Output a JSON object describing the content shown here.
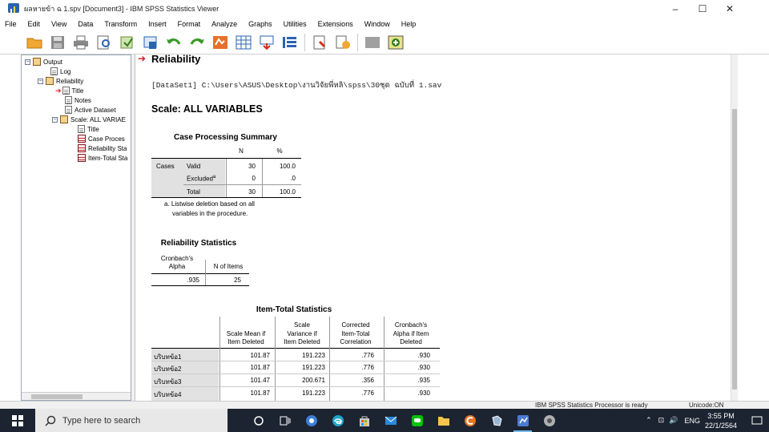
{
  "window": {
    "title": "ผลหายข้า ฉ 1.spv [Document3] - IBM SPSS Statistics Viewer",
    "minimize": "–",
    "maximize": "☐",
    "close": "✕"
  },
  "menu": [
    "File",
    "Edit",
    "View",
    "Data",
    "Transform",
    "Insert",
    "Format",
    "Analyze",
    "Graphs",
    "Utilities",
    "Extensions",
    "Window",
    "Help"
  ],
  "toolbar_icons": [
    "open-folder-icon",
    "save-icon",
    "print-icon",
    "print-preview-icon",
    "export-icon",
    "recall-dialog-icon",
    "undo-icon",
    "redo-icon",
    "goto-data-icon",
    "goto-case-icon",
    "goto-variable-icon",
    "variables-icon",
    "designate-window-icon",
    "insert-output-icon",
    "disabled-icon",
    "add-output-icon"
  ],
  "outline": {
    "nodes": [
      {
        "label": "Output",
        "type": "book",
        "expander": "−"
      },
      {
        "label": "Log",
        "type": "doc"
      },
      {
        "label": "Reliability",
        "type": "book",
        "expander": "−"
      },
      {
        "label": "Title",
        "type": "doc",
        "arrow": "➜"
      },
      {
        "label": "Notes",
        "type": "doc"
      },
      {
        "label": "Active Dataset",
        "type": "doc"
      },
      {
        "label": "Scale: ALL VARIAE",
        "type": "book",
        "expander": "−"
      },
      {
        "label": "Title",
        "type": "doc"
      },
      {
        "label": "Case Proces",
        "type": "tbl"
      },
      {
        "label": "Reliability Sta",
        "type": "tbl"
      },
      {
        "label": "Item-Total Sta",
        "type": "tbl"
      }
    ]
  },
  "content": {
    "heading": "Reliability",
    "heading_arrow": "➜",
    "dataset_line": "[DataSet1] C:\\Users\\ASUS\\Desktop\\งานวิจัยพี่หลิ\\spss\\30ชุด ฉบับที่ 1.sav",
    "scale_heading": "Scale: ALL VARIABLES",
    "case_summary": {
      "title": "Case Processing Summary",
      "col_n": "N",
      "col_pct": "%",
      "group": "Cases",
      "rows": [
        {
          "label": "Valid",
          "n": "30",
          "pct": "100.0"
        },
        {
          "label": "Excluded",
          "sup": "a",
          "n": "0",
          "pct": ".0"
        },
        {
          "label": "Total",
          "n": "30",
          "pct": "100.0"
        }
      ],
      "footnote_1": "a. Listwise deletion based on all",
      "footnote_2": "variables in the procedure."
    },
    "reliability": {
      "title": "Reliability Statistics",
      "col1_line1": "Cronbach's",
      "col1_line2": "Alpha",
      "col2": "N of Items",
      "alpha": ".935",
      "n_items": "25"
    },
    "item_total": {
      "title": "Item-Total Statistics",
      "headers": [
        [
          "",
          "Scale Mean if",
          "Item Deleted"
        ],
        [
          "Scale",
          "Variance if",
          "Item Deleted"
        ],
        [
          "Corrected",
          "Item-Total",
          "Correlation"
        ],
        [
          "Cronbach's",
          "Alpha if Item",
          "Deleted"
        ]
      ],
      "rows": [
        {
          "label": "บริบทข้อ1",
          "mean": "101.87",
          "var": "191.223",
          "corr": ".776",
          "alpha": ".930"
        },
        {
          "label": "บริบทข้อ2",
          "mean": "101.87",
          "var": "191.223",
          "corr": ".776",
          "alpha": ".930"
        },
        {
          "label": "บริบทข้อ3",
          "mean": "101.47",
          "var": "200.671",
          "corr": ".356",
          "alpha": ".935"
        },
        {
          "label": "บริบทข้อ4",
          "mean": "101.87",
          "var": "191.223",
          "corr": ".776",
          "alpha": ".930"
        }
      ]
    }
  },
  "status": {
    "processor": "IBM SPSS Statistics Processor is ready",
    "unicode": "Unicode:ON"
  },
  "taskbar": {
    "search_placeholder": "Type here to search",
    "lang": "ENG",
    "time": "3:55 PM",
    "date": "22/1/2564",
    "apps": [
      "search-circle-icon",
      "task-view-icon",
      "webcam-icon",
      "edge-icon",
      "store-icon",
      "mail-icon",
      "line-icon",
      "file-explorer-icon",
      "app-c-icon",
      "puzzle-icon",
      "spss-icon",
      "firefox-like-icon"
    ]
  },
  "colors": {
    "title_accent": "#2a63b0",
    "taskbar_bg": "#1c2431",
    "table_gray": "#e1e1e1",
    "arrow_red": "#dd2222"
  }
}
